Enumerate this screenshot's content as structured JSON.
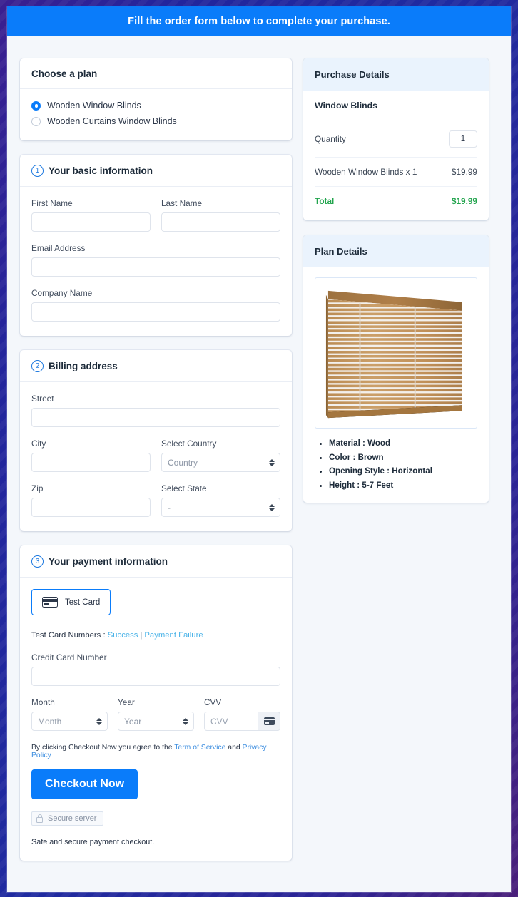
{
  "banner": {
    "title": "Fill the order form below to complete your purchase."
  },
  "plan_card": {
    "heading": "Choose a plan",
    "options": [
      {
        "label": "Wooden Window Blinds",
        "selected": true
      },
      {
        "label": "Wooden Curtains Window Blinds",
        "selected": false
      }
    ]
  },
  "basic_info": {
    "step": "1",
    "heading": "Your basic information",
    "first_name_label": "First Name",
    "first_name_value": "",
    "last_name_label": "Last Name",
    "last_name_value": "",
    "email_label": "Email Address",
    "email_value": "",
    "company_label": "Company Name",
    "company_value": ""
  },
  "billing": {
    "step": "2",
    "heading": "Billing address",
    "street_label": "Street",
    "street_value": "",
    "city_label": "City",
    "city_value": "",
    "country_label": "Select Country",
    "country_value": "Country",
    "zip_label": "Zip",
    "zip_value": "",
    "state_label": "Select State",
    "state_value": "-"
  },
  "payment": {
    "step": "3",
    "heading": "Your payment information",
    "card_tab_label": "Test  Card",
    "test_numbers_prefix": "Test Card Numbers : ",
    "test_success": "Success",
    "test_failure": "Payment Failure",
    "cc_label": "Credit Card Number",
    "cc_value": "",
    "month_label": "Month",
    "month_value": "Month",
    "year_label": "Year",
    "year_value": "Year",
    "cvv_label": "CVV",
    "cvv_placeholder": "CVV",
    "terms_prefix": "By clicking Checkout Now you agree to the ",
    "terms_link": "Term of Service",
    "terms_and": " and ",
    "privacy_link": "Privacy Policy",
    "checkout_label": "Checkout Now",
    "secure_badge": "Secure server",
    "safe_note": "Safe and secure payment checkout."
  },
  "purchase_details": {
    "heading": "Purchase Details",
    "product_title": "Window Blinds",
    "quantity_label": "Quantity",
    "quantity_value": "1",
    "line_item_label": "Wooden Window Blinds x 1",
    "line_item_price": "$19.99",
    "total_label": "Total",
    "total_value": "$19.99"
  },
  "plan_details": {
    "heading": "Plan Details",
    "image_alt": "wooden-window-blinds-photo",
    "specs": [
      "Material : Wood",
      "Color : Brown",
      "Opening Style : Horizontal",
      "Height : 5-7 Feet"
    ]
  },
  "colors": {
    "accent": "#0a7cfa",
    "total_green": "#22a44d",
    "link_light": "#4ab3e8",
    "panel_head": "#eaf3fd",
    "page_bg": "#f4f7fb"
  }
}
